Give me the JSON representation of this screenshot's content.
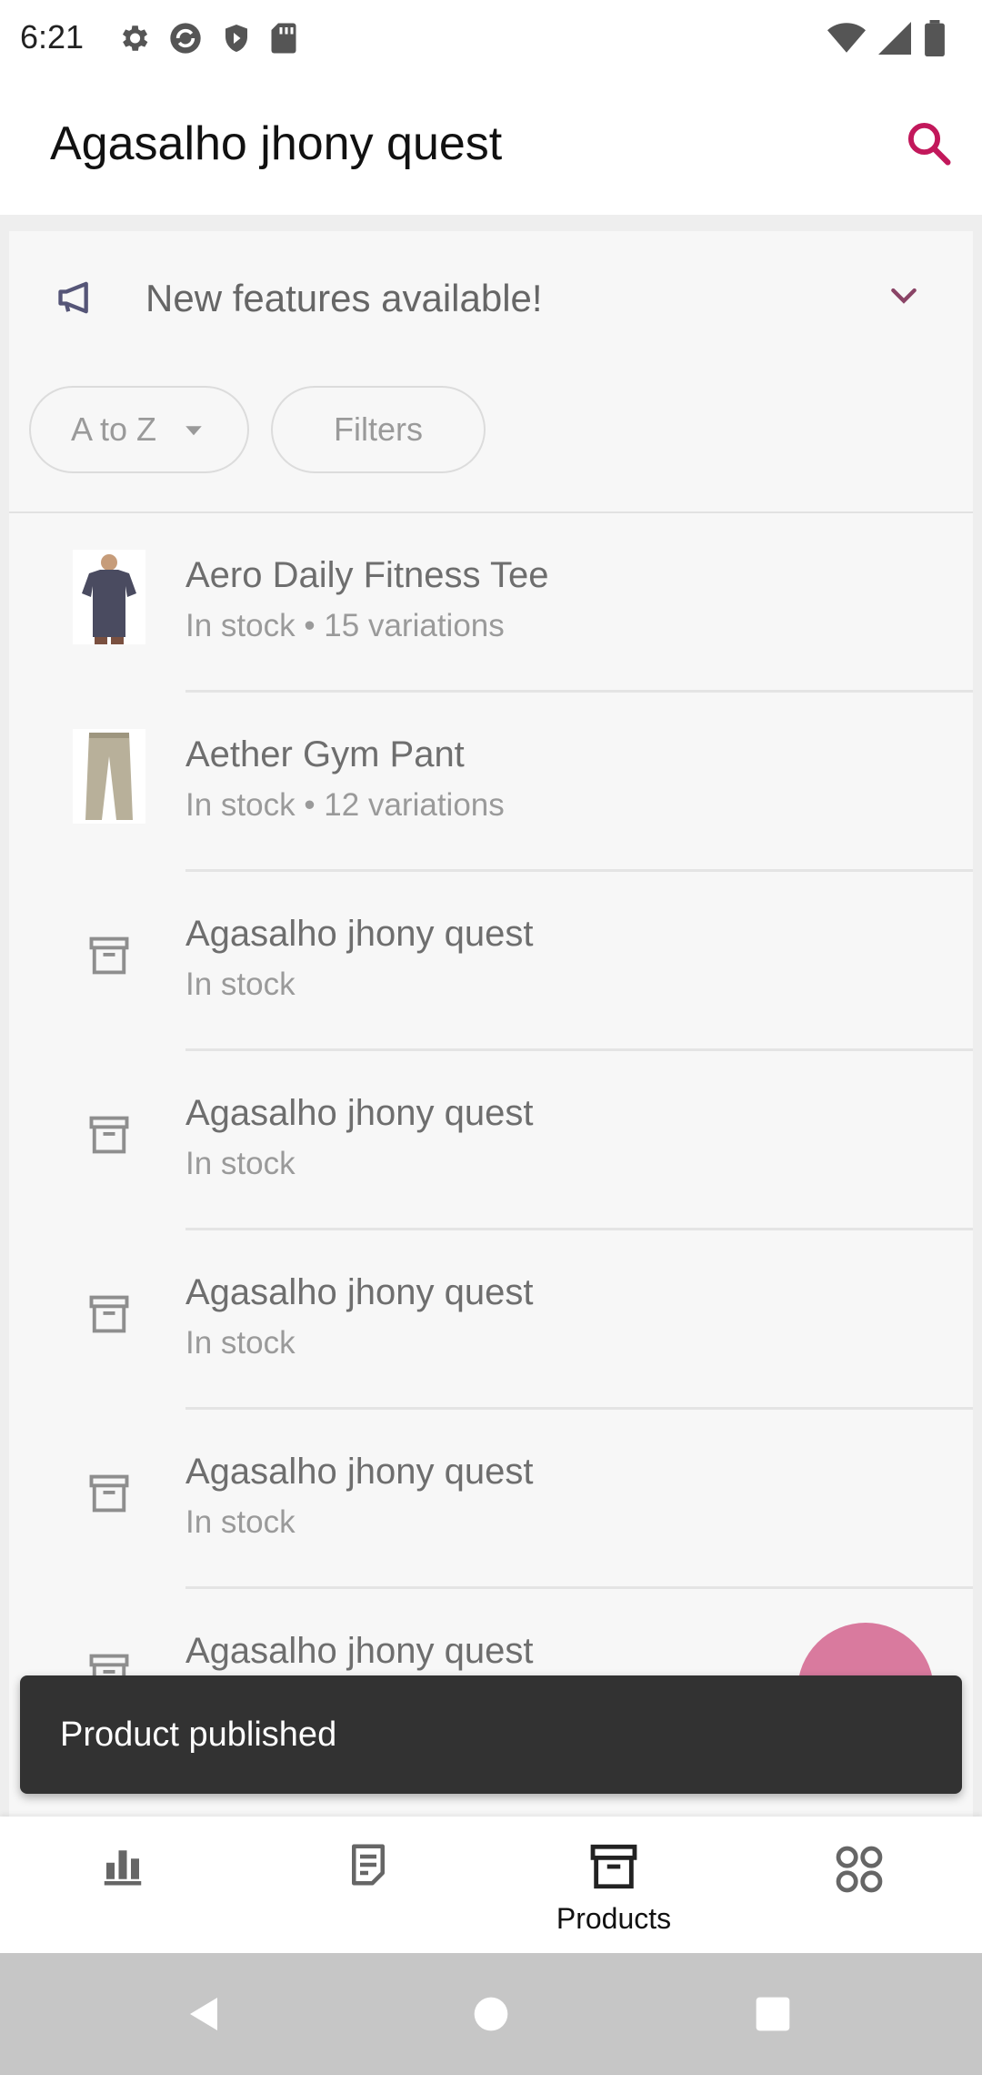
{
  "status_bar": {
    "time": "6:21",
    "left_icons": [
      "gear-icon",
      "sync-icon",
      "shield-icon",
      "sd-card-icon"
    ],
    "right_icons": [
      "wifi-icon",
      "signal-icon",
      "battery-icon"
    ]
  },
  "app_bar": {
    "title": "Agasalho jhony quest",
    "search_icon": "search-icon",
    "accent_color": "#c2185b"
  },
  "banner": {
    "icon": "megaphone-icon",
    "text": "New features available!",
    "chevron": "chevron-down-icon"
  },
  "chips": {
    "sort_label": "A to Z",
    "filter_label": "Filters"
  },
  "products": [
    {
      "name": "Aero Daily Fitness Tee",
      "subtitle": "In stock • 15 variations",
      "thumb": "tshirt-image"
    },
    {
      "name": "Aether Gym Pant",
      "subtitle": "In stock • 12 variations",
      "thumb": "pants-image"
    },
    {
      "name": "Agasalho jhony quest",
      "subtitle": "In stock",
      "thumb": "archive-box-icon"
    },
    {
      "name": "Agasalho jhony quest",
      "subtitle": "In stock",
      "thumb": "archive-box-icon"
    },
    {
      "name": "Agasalho jhony quest",
      "subtitle": "In stock",
      "thumb": "archive-box-icon"
    },
    {
      "name": "Agasalho jhony quest",
      "subtitle": "In stock",
      "thumb": "archive-box-icon"
    },
    {
      "name": "Agasalho jhony quest",
      "subtitle": "",
      "thumb": "archive-box-icon"
    }
  ],
  "fab": {
    "color": "#d97a9e"
  },
  "snackbar": {
    "text": "Product published"
  },
  "bottom_nav": {
    "items": [
      {
        "icon": "bar-chart-icon",
        "label": ""
      },
      {
        "icon": "orders-icon",
        "label": ""
      },
      {
        "icon": "products-box-icon",
        "label": "Products"
      },
      {
        "icon": "more-grid-icon",
        "label": ""
      }
    ],
    "selected": "Products"
  },
  "system_nav": {
    "buttons": [
      "back-icon",
      "home-icon",
      "recents-icon"
    ]
  }
}
